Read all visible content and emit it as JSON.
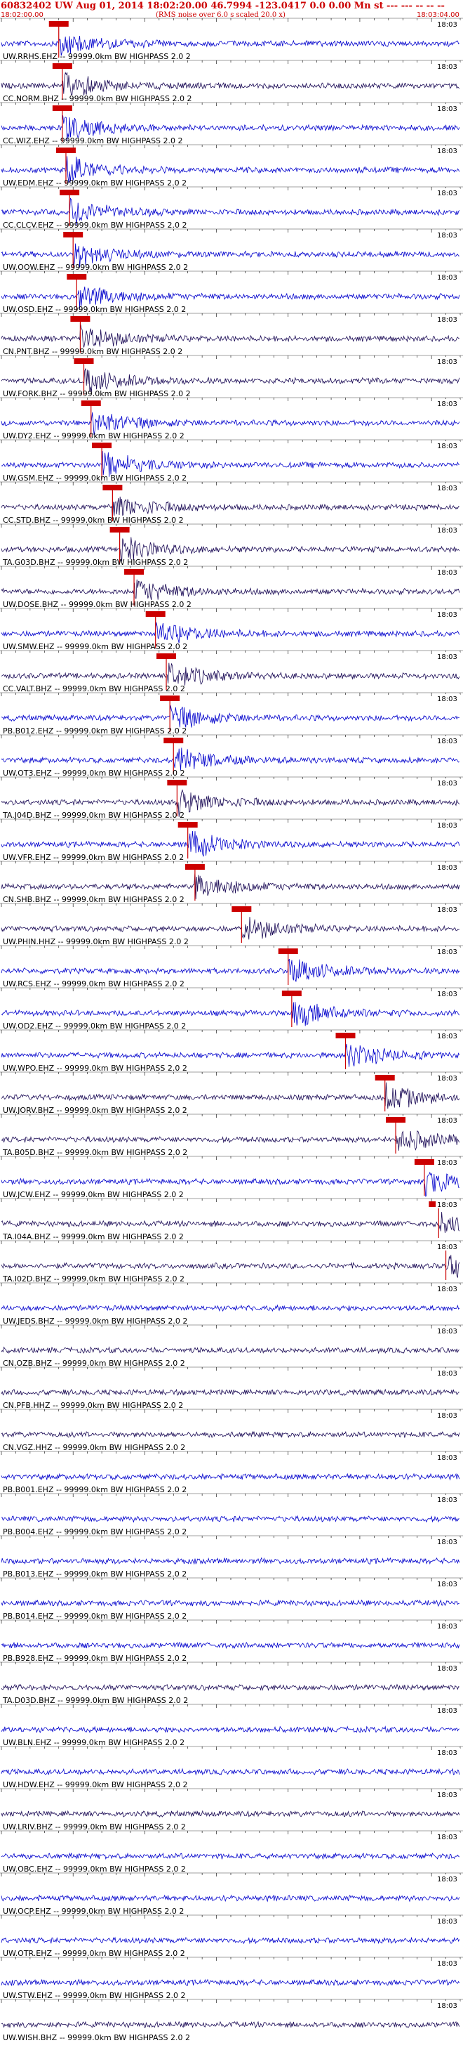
{
  "header": {
    "title": "60832402 UW Aug 01, 2014 18:02:20.00    46.7994 -123.0417   0.0 0.00 Mn st --- --- -- -- --",
    "subtitle": "(RMS noise over 6.0 s scaled 20.0 x)",
    "start_time": "18:02:00.00",
    "end_time": "18:03:04.00"
  },
  "colors": {
    "title": "#cc0000",
    "pick": "#cc0000",
    "trace_a": "#0000cc",
    "trace_b": "#1a0a55",
    "label": "#000000"
  },
  "trace_time_label": "18:03",
  "chart_data": {
    "type": "seismogram",
    "time_range_s": [
      0,
      64
    ],
    "traces": [
      {
        "label": "UW.RRHS.EHZ -- 99999.0km BW  HIGHPASS  2.0  2",
        "pick_s": 8.0,
        "color": "a"
      },
      {
        "label": "CC.NORM.BHZ -- 99999.0km BW  HIGHPASS  2.0  2",
        "pick_s": 8.5,
        "color": "b"
      },
      {
        "label": "CC.WIZ.EHZ -- 99999.0km BW  HIGHPASS  2.0  2",
        "pick_s": 8.5,
        "color": "a"
      },
      {
        "label": "UW.EDM.EHZ -- 99999.0km BW  HIGHPASS  2.0  2",
        "pick_s": 9.0,
        "color": "a"
      },
      {
        "label": "CC.CLCV.EHZ -- 99999.0km BW  HIGHPASS  2.0  2",
        "pick_s": 9.5,
        "color": "a"
      },
      {
        "label": "UW.OOW.EHZ -- 99999.0km BW  HIGHPASS  2.0  2",
        "pick_s": 10.0,
        "color": "a"
      },
      {
        "label": "UW.OSD.EHZ -- 99999.0km BW  HIGHPASS  2.0  2",
        "pick_s": 10.5,
        "color": "a"
      },
      {
        "label": "CN.PNT.BHZ -- 99999.0km BW  HIGHPASS  2.0  2",
        "pick_s": 11.0,
        "color": "b"
      },
      {
        "label": "UW.FORK.BHZ -- 99999.0km BW  HIGHPASS  2.0  2",
        "pick_s": 11.5,
        "color": "b"
      },
      {
        "label": "UW.DY2.EHZ -- 99999.0km BW  HIGHPASS  2.0  2",
        "pick_s": 12.5,
        "color": "a"
      },
      {
        "label": "UW.GSM.EHZ -- 99999.0km BW  HIGHPASS  2.0  2",
        "pick_s": 14.0,
        "color": "a"
      },
      {
        "label": "CC.STD.BHZ -- 99999.0km BW  HIGHPASS  2.0  2",
        "pick_s": 15.5,
        "color": "b"
      },
      {
        "label": "TA.G03D.BHZ -- 99999.0km BW  HIGHPASS  2.0  2",
        "pick_s": 16.5,
        "color": "b"
      },
      {
        "label": "UW.DOSE.BHZ -- 99999.0km BW  HIGHPASS  2.0  2",
        "pick_s": 18.5,
        "color": "b"
      },
      {
        "label": "UW.SMW.EHZ -- 99999.0km BW  HIGHPASS  2.0  2",
        "pick_s": 21.5,
        "color": "a"
      },
      {
        "label": "CC.VALT.BHZ -- 99999.0km BW  HIGHPASS  2.0  2",
        "pick_s": 23.0,
        "color": "b"
      },
      {
        "label": "PB.B012.EHZ -- 99999.0km BW  HIGHPASS  2.0  2",
        "pick_s": 23.5,
        "color": "a"
      },
      {
        "label": "UW.OT3.EHZ -- 99999.0km BW  HIGHPASS  2.0  2",
        "pick_s": 24.0,
        "color": "a"
      },
      {
        "label": "TA.J04D.BHZ -- 99999.0km BW  HIGHPASS  2.0  2",
        "pick_s": 24.5,
        "color": "b"
      },
      {
        "label": "UW.VFR.EHZ -- 99999.0km BW  HIGHPASS  2.0  2",
        "pick_s": 26.0,
        "color": "a"
      },
      {
        "label": "CN.SHB.BHZ -- 99999.0km BW  HIGHPASS  2.0  2",
        "pick_s": 27.0,
        "color": "b"
      },
      {
        "label": "UW.PHIN.HHZ -- 99999.0km BW  HIGHPASS  2.0  2",
        "pick_s": 33.5,
        "color": "b"
      },
      {
        "label": "UW.RCS.EHZ -- 99999.0km BW  HIGHPASS  2.0  2",
        "pick_s": 40.0,
        "color": "a"
      },
      {
        "label": "UW.OD2.EHZ -- 99999.0km BW  HIGHPASS  2.0  2",
        "pick_s": 40.5,
        "color": "a"
      },
      {
        "label": "UW.WPO.EHZ -- 99999.0km BW  HIGHPASS  2.0  2",
        "pick_s": 48.0,
        "color": "a"
      },
      {
        "label": "UW.JORV.BHZ -- 99999.0km BW  HIGHPASS  2.0  2",
        "pick_s": 53.5,
        "color": "b"
      },
      {
        "label": "TA.B05D.BHZ -- 99999.0km BW  HIGHPASS  2.0  2",
        "pick_s": 55.0,
        "color": "b"
      },
      {
        "label": "UW.JCW.EHZ -- 99999.0km BW  HIGHPASS  2.0  2",
        "pick_s": 59.0,
        "color": "a"
      },
      {
        "label": "TA.I04A.BHZ -- 99999.0km BW  HIGHPASS  2.0  2",
        "pick_s": 61.0,
        "color": "b"
      },
      {
        "label": "TA.I02D.BHZ -- 99999.0km BW  HIGHPASS  2.0  2",
        "pick_s": 62.0,
        "color": "b"
      },
      {
        "label": "UW.JEDS.BHZ -- 99999.0km BW  HIGHPASS  2.0  2",
        "pick_s": null,
        "color": "a"
      },
      {
        "label": "CN.OZB.BHZ -- 99999.0km BW  HIGHPASS  2.0  2",
        "pick_s": null,
        "color": "b"
      },
      {
        "label": "CN.PFB.HHZ -- 99999.0km BW  HIGHPASS  2.0  2",
        "pick_s": null,
        "color": "b"
      },
      {
        "label": "CN.VGZ.HHZ -- 99999.0km BW  HIGHPASS  2.0  2",
        "pick_s": null,
        "color": "b"
      },
      {
        "label": "PB.B001.EHZ -- 99999.0km BW  HIGHPASS  2.0  2",
        "pick_s": null,
        "color": "a"
      },
      {
        "label": "PB.B004.EHZ -- 99999.0km BW  HIGHPASS  2.0  2",
        "pick_s": null,
        "color": "a"
      },
      {
        "label": "PB.B013.EHZ -- 99999.0km BW  HIGHPASS  2.0  2",
        "pick_s": null,
        "color": "a"
      },
      {
        "label": "PB.B014.EHZ -- 99999.0km BW  HIGHPASS  2.0  2",
        "pick_s": null,
        "color": "a"
      },
      {
        "label": "PB.B928.EHZ -- 99999.0km BW  HIGHPASS  2.0  2",
        "pick_s": null,
        "color": "a"
      },
      {
        "label": "TA.D03D.BHZ -- 99999.0km BW  HIGHPASS  2.0  2",
        "pick_s": null,
        "color": "b"
      },
      {
        "label": "UW.BLN.EHZ -- 99999.0km BW  HIGHPASS  2.0  2",
        "pick_s": null,
        "color": "a"
      },
      {
        "label": "UW.HDW.EHZ -- 99999.0km BW  HIGHPASS  2.0  2",
        "pick_s": null,
        "color": "a"
      },
      {
        "label": "UW.LRIV.BHZ -- 99999.0km BW  HIGHPASS  2.0  2",
        "pick_s": null,
        "color": "b"
      },
      {
        "label": "UW.OBC.EHZ -- 99999.0km BW  HIGHPASS  2.0  2",
        "pick_s": null,
        "color": "a"
      },
      {
        "label": "UW.OCP.EHZ -- 99999.0km BW  HIGHPASS  2.0  2",
        "pick_s": null,
        "color": "a"
      },
      {
        "label": "UW.OTR.EHZ -- 99999.0km BW  HIGHPASS  2.0  2",
        "pick_s": null,
        "color": "a"
      },
      {
        "label": "UW.STW.EHZ -- 99999.0km BW  HIGHPASS  2.0  2",
        "pick_s": null,
        "color": "a"
      },
      {
        "label": "UW.WISH.BHZ -- 99999.0km BW  HIGHPASS  2.0  2",
        "pick_s": null,
        "color": "b"
      }
    ]
  }
}
